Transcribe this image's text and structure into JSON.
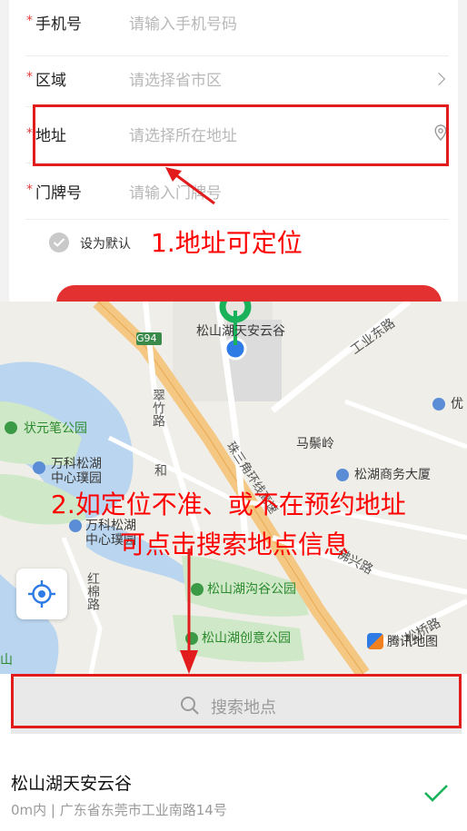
{
  "form": {
    "rows": [
      {
        "required": "*",
        "label": "手机号",
        "placeholder": "请输入手机号码"
      },
      {
        "required": "*",
        "label": "区域",
        "placeholder": "请选择省市区"
      },
      {
        "required": "*",
        "label": "地址",
        "placeholder": "请选择所在地址"
      },
      {
        "required": "*",
        "label": "门牌号",
        "placeholder": "请输入门牌号"
      }
    ],
    "default_label": "设为默认"
  },
  "annotations": {
    "note1": "1.地址可定位",
    "note2_line1": "2.如定位不准、或不在预约地址",
    "note2_line2": "可点击搜索地点信息",
    "color": "#ff0000"
  },
  "map": {
    "pin_label": "松山湖天安云谷",
    "road_code": "G94",
    "labels": {
      "gongye_east": "工业东路",
      "zhuangyuan": "状元笔公园",
      "cuizhu": "翠竹路",
      "majiling": "马鬃岭",
      "wanke1_l1": "万科松湖",
      "wanke1_l2": "中心璞园",
      "wanke2_l1": "万科松湖",
      "wanke2_l2": "中心璞园",
      "he": "和",
      "zhusanjiao": "珠三角环线高速",
      "songhu_business": "松湖商务大厦",
      "you": "优",
      "foxing": "佛兴路",
      "hongmian": "红棉路",
      "songshanhu_gou": "松山湖沟谷公园",
      "songshanhu_chuangyi": "松山湖创意公园",
      "songqiao": "松桥路",
      "shan": "山",
      "tencent": "腾讯地图"
    },
    "colors": {
      "park": "#cfe8c7",
      "water": "#b9d5ef",
      "highway": "#f4c783",
      "pin": "#19b25a",
      "locate": "#2f7be6"
    }
  },
  "sheet": {
    "search_placeholder": "搜索地点",
    "result": {
      "name": "松山湖天安云谷",
      "address": "0m内 | 广东省东莞市工业南路14号"
    }
  }
}
